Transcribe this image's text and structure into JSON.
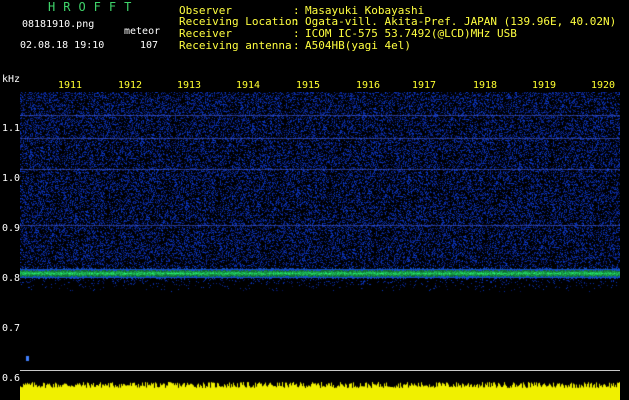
{
  "header": {
    "title": "HROFFT",
    "filename": "08181910.png",
    "meteor_label": "meteor",
    "datetime": "02.08.18 19:10",
    "meteor_count": "107"
  },
  "info": [
    {
      "key": "Observer",
      "sep": ":",
      "value": "Masayuki Kobayashi"
    },
    {
      "key": "Receiving Location",
      "sep": ":",
      "value": "Ogata-vill. Akita-Pref. JAPAN (139.96E, 40.02N)"
    },
    {
      "key": "Receiver",
      "sep": ":",
      "value": "ICOM IC-575 53.7492(@LCD)MHz USB"
    },
    {
      "key": "Receiving antenna",
      "sep": ":",
      "value": "A504HB(yagi 4el)"
    }
  ],
  "y_axis": {
    "unit": "kHz",
    "ticks": [
      "1.1",
      "1.0",
      "0.9",
      "0.8",
      "0.7",
      "0.6"
    ]
  },
  "x_axis": {
    "ticks": [
      "1911",
      "1912",
      "1913",
      "1914",
      "1915",
      "1916",
      "1917",
      "1918",
      "1919",
      "1920"
    ]
  },
  "colors": {
    "background": "#000000",
    "title": "#3fd46a",
    "info_text": "#ffff40",
    "tick_text": "#ffff30",
    "signal_band": "#3cff6e",
    "noise": "#1a2aa0",
    "bar_fill": "#f0f000"
  },
  "spectrogram": {
    "band_khz": 0.81
  }
}
